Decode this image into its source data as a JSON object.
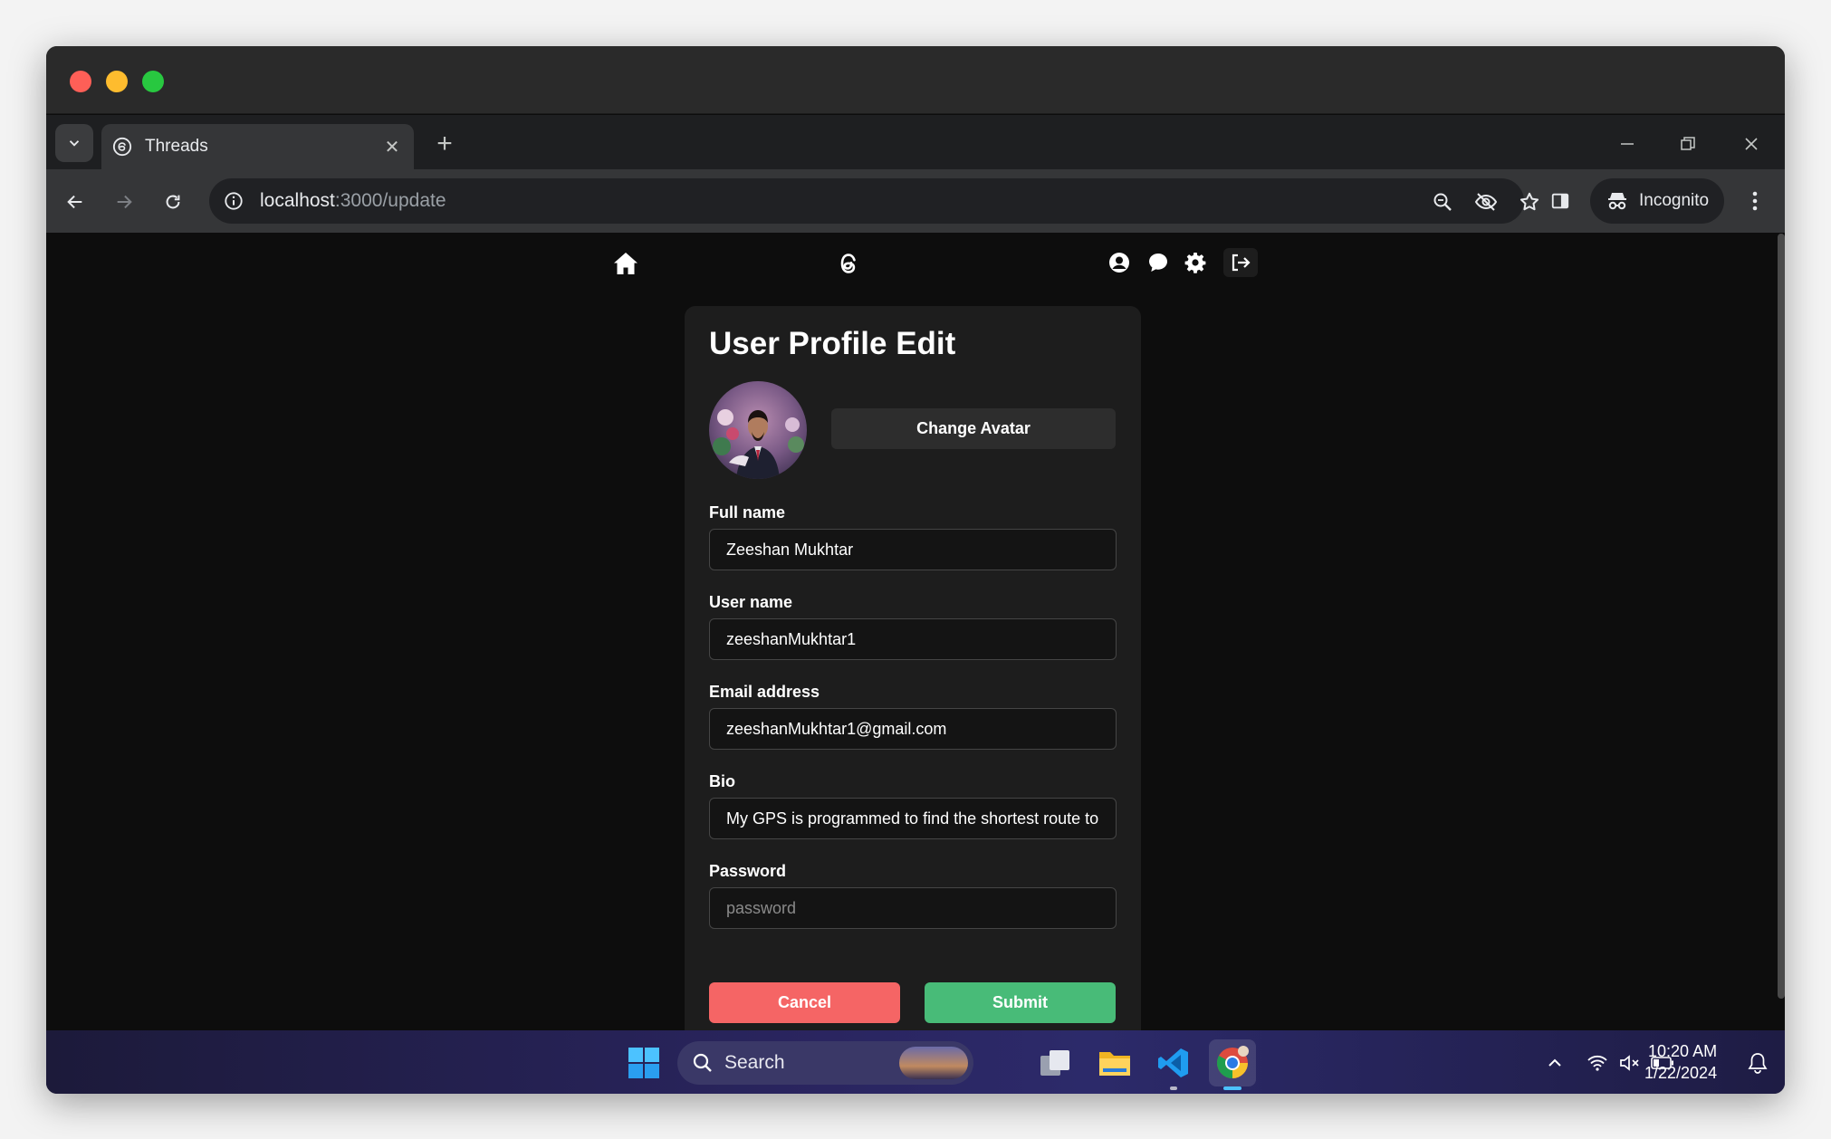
{
  "browser": {
    "tab_title": "Threads",
    "url_host": "localhost",
    "url_path": ":3000/update",
    "profile_label": "Incognito"
  },
  "app": {
    "nav_icons": [
      "home-icon",
      "threads-logo-icon",
      "user-icon",
      "chat-icon",
      "settings-icon",
      "logout-icon"
    ]
  },
  "form": {
    "title": "User Profile Edit",
    "change_avatar_label": "Change Avatar",
    "fields": {
      "full_name": {
        "label": "Full name",
        "value": "Zeeshan Mukhtar"
      },
      "user_name": {
        "label": "User name",
        "value": "zeeshanMukhtar1"
      },
      "email": {
        "label": "Email address",
        "value": "zeeshanMukhtar1@gmail.com"
      },
      "bio": {
        "label": "Bio",
        "value": "My GPS is programmed to find the shortest route to"
      },
      "password": {
        "label": "Password",
        "placeholder": "password",
        "value": ""
      }
    },
    "cancel_label": "Cancel",
    "submit_label": "Submit"
  },
  "taskbar": {
    "search_label": "Search",
    "time": "10:20 AM",
    "date": "1/22/2024"
  },
  "colors": {
    "cancel": "#f56565",
    "submit": "#48bb78",
    "card_bg": "#1d1d1d",
    "page_bg": "#0d0d0d"
  }
}
